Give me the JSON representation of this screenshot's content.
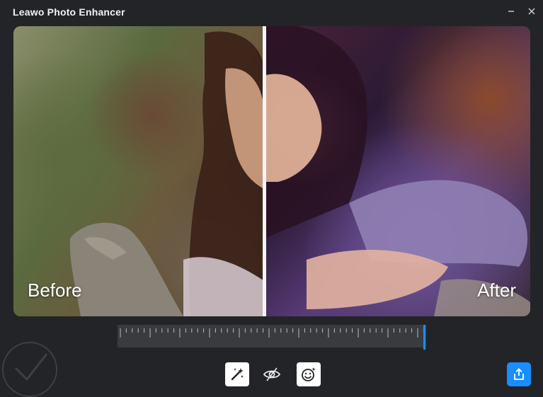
{
  "window": {
    "title": "Leawo Photo Enhancer",
    "controls": {
      "minimize_icon": "minimize-icon",
      "close_icon": "close-icon"
    }
  },
  "comparison": {
    "before_label": "Before",
    "after_label": "After",
    "split_fraction": 0.485
  },
  "timeline": {
    "playhead_fraction": 0.995
  },
  "tools": [
    {
      "name": "magic-wand",
      "icon": "magic-wand-icon"
    },
    {
      "name": "compare-view",
      "icon": "eye-compare-icon"
    },
    {
      "name": "face-enhance",
      "icon": "face-sparkle-icon"
    }
  ],
  "share": {
    "icon": "share-icon"
  },
  "colors": {
    "accent": "#1a8dff",
    "background": "#232427",
    "timeline": "#3a3b3f"
  }
}
